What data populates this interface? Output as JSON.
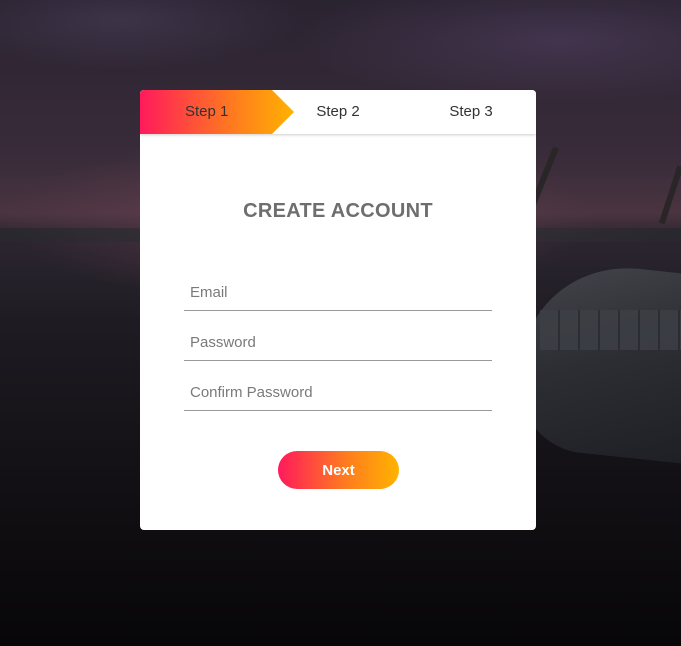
{
  "steps": {
    "step1": "Step 1",
    "step2": "Step 2",
    "step3": "Step 3",
    "active": 1
  },
  "form": {
    "title": "CREATE ACCOUNT",
    "email_placeholder": "Email",
    "password_placeholder": "Password",
    "confirm_placeholder": "Confirm Password",
    "email_value": "",
    "password_value": "",
    "confirm_value": "",
    "next_label": "Next"
  },
  "colors": {
    "gradient_start": "#ff1a5c",
    "gradient_mid": "#ff7a1f",
    "gradient_end": "#ffb300",
    "title": "#6e6e6e",
    "card": "#ffffff"
  }
}
